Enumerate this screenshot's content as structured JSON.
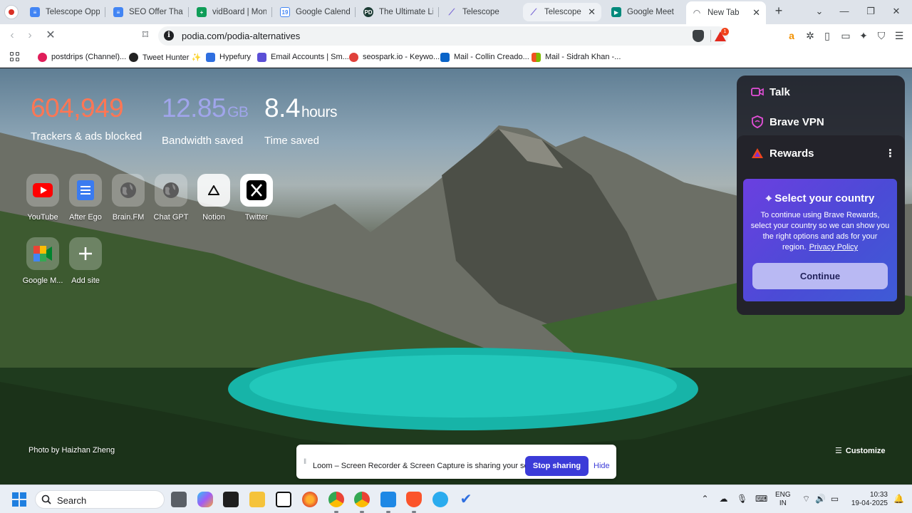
{
  "tabs": [
    {
      "title": "Telescope Oppor",
      "favicon": "google-docs-icon",
      "color": "#4285f4"
    },
    {
      "title": "SEO Offer That's",
      "favicon": "google-docs-icon",
      "color": "#4285f4"
    },
    {
      "title": "vidBoard | Mone",
      "favicon": "google-sheets-icon",
      "color": "#0f9d58"
    },
    {
      "title": "Google Calendar",
      "favicon": "google-calendar-icon",
      "color": "#4285f4"
    },
    {
      "title": "The Ultimate Lin",
      "favicon": "pd-icon",
      "color": "#1b5e4a"
    },
    {
      "title": "Telescope",
      "favicon": "telescope-icon",
      "color": "#7c6ad6"
    },
    {
      "title": "Telescope | A",
      "favicon": "telescope-icon",
      "color": "#7c6ad6"
    },
    {
      "title": "Google Meet",
      "favicon": "google-meet-icon",
      "color": "#00897b"
    },
    {
      "title": "New Tab",
      "favicon": "loading-icon",
      "color": "#5f6368"
    }
  ],
  "toolbar": {
    "url": "podia.com/podia-alternatives",
    "rewards_badge": "1"
  },
  "bookmarks": [
    {
      "label": "postdrips (Channel)...",
      "color": "#e01e5a"
    },
    {
      "label": "Tweet Hunter ✨",
      "color": "#222222"
    },
    {
      "label": "Hypefury",
      "color": "#2f6fe0"
    },
    {
      "label": "Email Accounts | Sm...",
      "color": "#5b4fd6"
    },
    {
      "label": "seospark.io - Keywo...",
      "color": "#e0403a"
    },
    {
      "label": "Mail - Collin Creado...",
      "color": "#0a64c8"
    },
    {
      "label": "Mail - Sidrah Khan -...",
      "color": "#f25022"
    }
  ],
  "stats": {
    "trackers": {
      "value": "604,949",
      "label": "Trackers & ads blocked",
      "color": "#ff7654"
    },
    "bandwidth": {
      "value": "12.85",
      "unit": "GB",
      "label": "Bandwidth saved",
      "color": "#a0a5eb"
    },
    "time": {
      "value": "8.4",
      "unit": "hours",
      "label": "Time saved",
      "color": "#ffffff"
    }
  },
  "top_sites": [
    {
      "label": "YouTube",
      "icon": "youtube-icon"
    },
    {
      "label": "After Ego",
      "icon": "document-icon"
    },
    {
      "label": "Brain.FM",
      "icon": "globe-icon"
    },
    {
      "label": "Chat GPT",
      "icon": "globe-icon"
    },
    {
      "label": "Notion",
      "icon": "notion-icon"
    },
    {
      "label": "Twitter",
      "icon": "x-icon"
    },
    {
      "label": "Google M...",
      "icon": "google-meet-icon"
    },
    {
      "label": "Add site",
      "icon": "plus-icon"
    }
  ],
  "panel": {
    "talk": "Talk",
    "vpn": "Brave VPN",
    "rewards": "Rewards",
    "card_title": "Select your country",
    "card_desc": "To continue using Brave Rewards, select your country so we can show you the right options and ads for your region.",
    "privacy_link": "Privacy Policy",
    "continue": "Continue"
  },
  "photo_credit": "Photo by Haizhan Zheng",
  "customize": "Customize",
  "loom": {
    "text": "Loom – Screen Recorder & Screen Capture is sharing your screen.",
    "stop": "Stop sharing",
    "hide": "Hide"
  },
  "taskbar": {
    "search": "Search",
    "lang_top": "ENG",
    "lang_bottom": "IN",
    "time": "10:33",
    "date": "19-04-2025"
  }
}
